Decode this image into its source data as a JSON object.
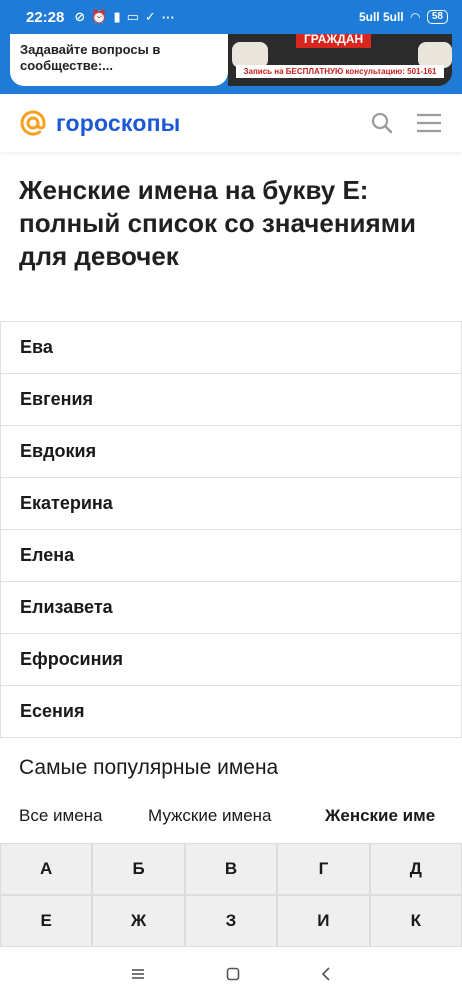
{
  "status_bar": {
    "time": "22:28",
    "network": "5ull 5ull",
    "battery": "58"
  },
  "ad": {
    "text": "Задавайте вопросы в сообществе:...",
    "image_caption": "ГРАЖДАН",
    "image_note": "Запись на БЕСПЛАТНУЮ консультацию: 501-161"
  },
  "header": {
    "logo_text": "гороскопы",
    "accent_color": "#f79f1f",
    "brand_color": "#1b59d6"
  },
  "page": {
    "title": "Женские имена на букву Е: полный список со значениями для девочек"
  },
  "names": [
    "Ева",
    "Евгения",
    "Евдокия",
    "Екатерина",
    "Елена",
    "Елизавета",
    "Ефросиния",
    "Есения"
  ],
  "popular_heading": "Самые популярные имена",
  "tabs": [
    {
      "label": "Все имена",
      "active": false
    },
    {
      "label": "Мужские имена",
      "active": false
    },
    {
      "label": "Женские име",
      "active": true
    }
  ],
  "letters": [
    "А",
    "Б",
    "В",
    "Г",
    "Д",
    "Е",
    "Ж",
    "З",
    "И",
    "К"
  ]
}
